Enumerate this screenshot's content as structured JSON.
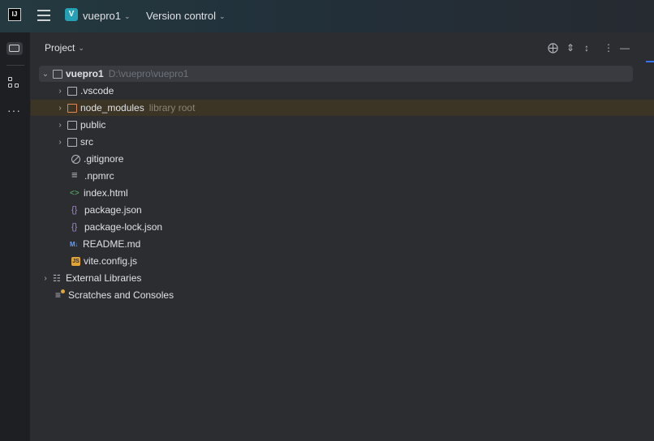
{
  "titlebar": {
    "logo_text": "IJ",
    "project_badge": "V",
    "project_name": "vuepro1",
    "vcs": "Version control"
  },
  "panel": {
    "title": "Project",
    "header_icons": [
      "locate-icon",
      "expand-collapse-icon",
      "collapse-all-icon",
      "options-icon",
      "hide-icon"
    ]
  },
  "tree": {
    "root": {
      "name": "vuepro1",
      "path": "D:\\vuepro\\vuepro1"
    },
    "items": [
      {
        "name": ".vscode"
      },
      {
        "name": "node_modules",
        "note": "library root"
      },
      {
        "name": "public"
      },
      {
        "name": "src"
      },
      {
        "name": ".gitignore"
      },
      {
        "name": ".npmrc"
      },
      {
        "name": "index.html"
      },
      {
        "name": "package.json"
      },
      {
        "name": "package-lock.json"
      },
      {
        "name": "README.md"
      },
      {
        "name": "vite.config.js"
      }
    ],
    "external": "External Libraries",
    "scratches": "Scratches and Consoles"
  },
  "colors": {
    "accent": "#3574f0",
    "library_row": "#3c3526",
    "selection": "#393b40",
    "html_icon": "#5fb86b",
    "json_icon": "#a77fdc",
    "js_icon": "#e3a437"
  }
}
